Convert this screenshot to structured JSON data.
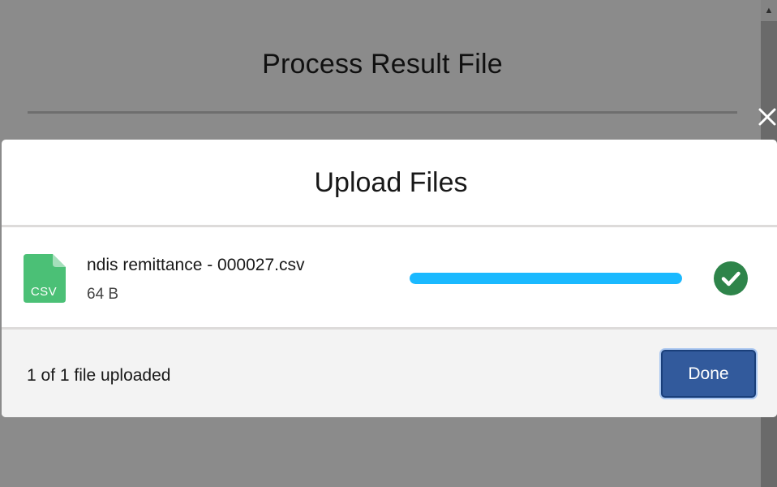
{
  "background": {
    "modal_title": "Process Result File"
  },
  "close_icon": "close-icon",
  "upload_modal": {
    "title": "Upload Files",
    "file": {
      "icon": "csv-file-icon",
      "icon_label": "CSV",
      "icon_color": "#4bc076",
      "name": "ndis remittance - 000027.csv",
      "size": "64 B",
      "progress_fraction": 1.0,
      "progress_color": "#1ab9ff",
      "status_icon": "success-check-icon",
      "status_color": "#2e844a"
    },
    "footer": {
      "status_text": "1 of 1 file uploaded",
      "done_label": "Done",
      "done_color": "#325a9c"
    }
  }
}
